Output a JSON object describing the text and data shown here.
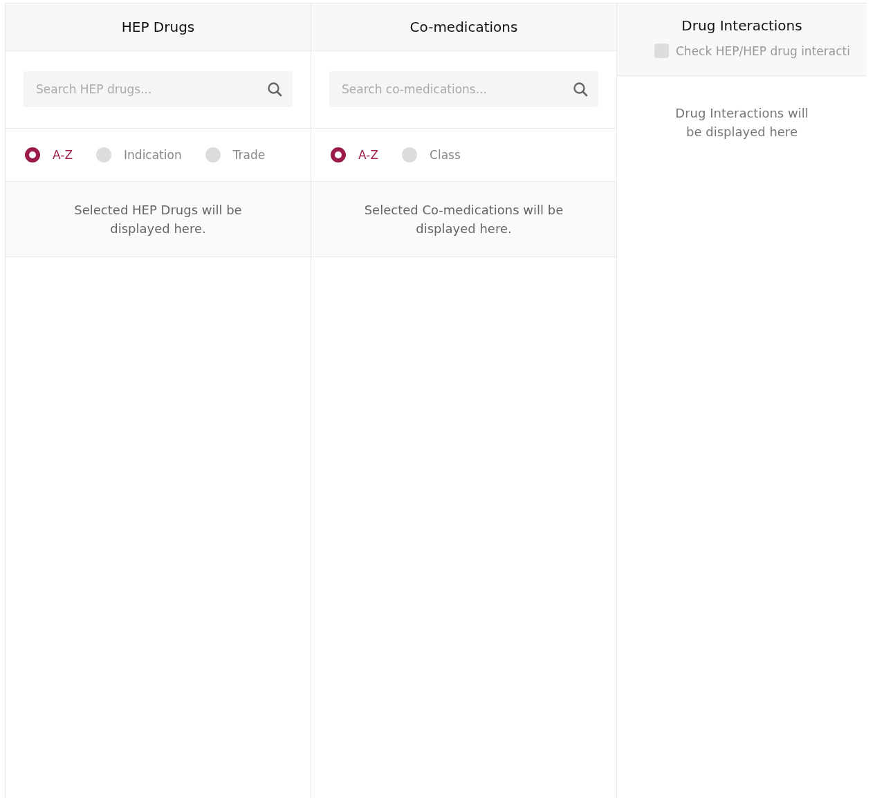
{
  "panels": [
    {
      "kind": "search",
      "title": "HEP Drugs",
      "search": {
        "placeholder": "Search HEP drugs..."
      },
      "sort_options": [
        {
          "label": "A-Z",
          "selected": true
        },
        {
          "label": "Indication",
          "selected": false
        },
        {
          "label": "Trade",
          "selected": false
        }
      ],
      "empty_message": "Selected HEP Drugs will be displayed here."
    },
    {
      "kind": "search",
      "title": "Co-medications",
      "search": {
        "placeholder": "Search co-medications..."
      },
      "sort_options": [
        {
          "label": "A-Z",
          "selected": true
        },
        {
          "label": "Class",
          "selected": false
        }
      ],
      "empty_message": "Selected Co-medications will be displayed here."
    },
    {
      "kind": "results",
      "title": "Drug Interactions",
      "checkbox": {
        "label": "Check HEP/HEP drug interacti",
        "checked": false
      },
      "empty_message": "Drug Interactions will be displayed here"
    }
  ]
}
